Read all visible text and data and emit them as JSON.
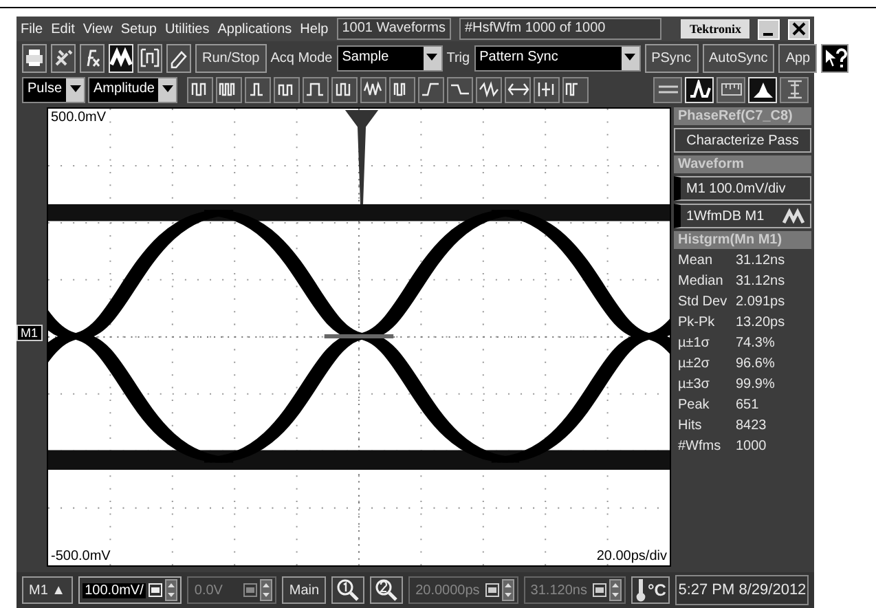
{
  "menu_bar": {
    "items": [
      "File",
      "Edit",
      "View",
      "Setup",
      "Utilities",
      "Applications",
      "Help"
    ],
    "waveform_count": "1001 Waveforms",
    "waveform_index": "#HsfWfm  1000 of 1000",
    "brand": "Tektronix"
  },
  "toolbar": {
    "icons": [
      {
        "selected": false
      },
      {
        "selected": false
      },
      {
        "selected": false
      },
      {
        "selected": true
      },
      {
        "selected": false
      },
      {
        "selected": false
      }
    ],
    "run_stop": "Run/Stop",
    "acq_mode_label": "Acq Mode",
    "acq_mode": "Sample",
    "trig_label": "Trig",
    "trig": "Pattern Sync",
    "buttons": [
      "PSync",
      "AutoSync",
      "App"
    ]
  },
  "measure_bar": {
    "category": "Pulse",
    "type": "Amplitude",
    "view_icons": [
      {
        "selected": false
      },
      {
        "selected": true
      },
      {
        "selected": false
      },
      {
        "selected": true
      },
      {
        "selected": false
      }
    ]
  },
  "graticule": {
    "top_label": "500.0mV",
    "bottom_label": "-500.0mV",
    "timebase": "20.00ps/div",
    "channel_marker": "M1"
  },
  "side_panel": {
    "phase_ref_title": "PhaseRef(C7_C8)",
    "characterize": "Characterize  Pass",
    "waveform_title": "Waveform",
    "waveform_scale": "M1 100.0mV/div",
    "waveform_db": "1WfmDB M1",
    "histogram_title": "Histgrm(Mn M1)",
    "stats": [
      {
        "label": "Mean",
        "value": "31.12ns"
      },
      {
        "label": "Median",
        "value": "31.12ns"
      },
      {
        "label": "Std Dev",
        "value": "2.091ps"
      },
      {
        "label": "Pk-Pk",
        "value": "13.20ps"
      },
      {
        "label": "µ±1σ",
        "value": "74.3%"
      },
      {
        "label": "µ±2σ",
        "value": "96.6%"
      },
      {
        "label": "µ±3σ",
        "value": "99.9%"
      },
      {
        "label": "Peak",
        "value": "651"
      },
      {
        "label": "Hits",
        "value": "8423"
      },
      {
        "label": "#Wfms",
        "value": "1000"
      }
    ]
  },
  "bottom_bar": {
    "channel": "M1 ▲",
    "fields": [
      {
        "value": "100.0mV/",
        "disabled": false
      },
      {
        "value": "0.0V",
        "disabled": true
      }
    ],
    "timebase_button": "Main",
    "time_fields": [
      {
        "value": "20.0000ps",
        "disabled": true
      },
      {
        "value": "31.120ns",
        "disabled": true
      }
    ],
    "temperature_unit": "°C",
    "datetime": "5:27 PM 8/29/2012"
  }
}
